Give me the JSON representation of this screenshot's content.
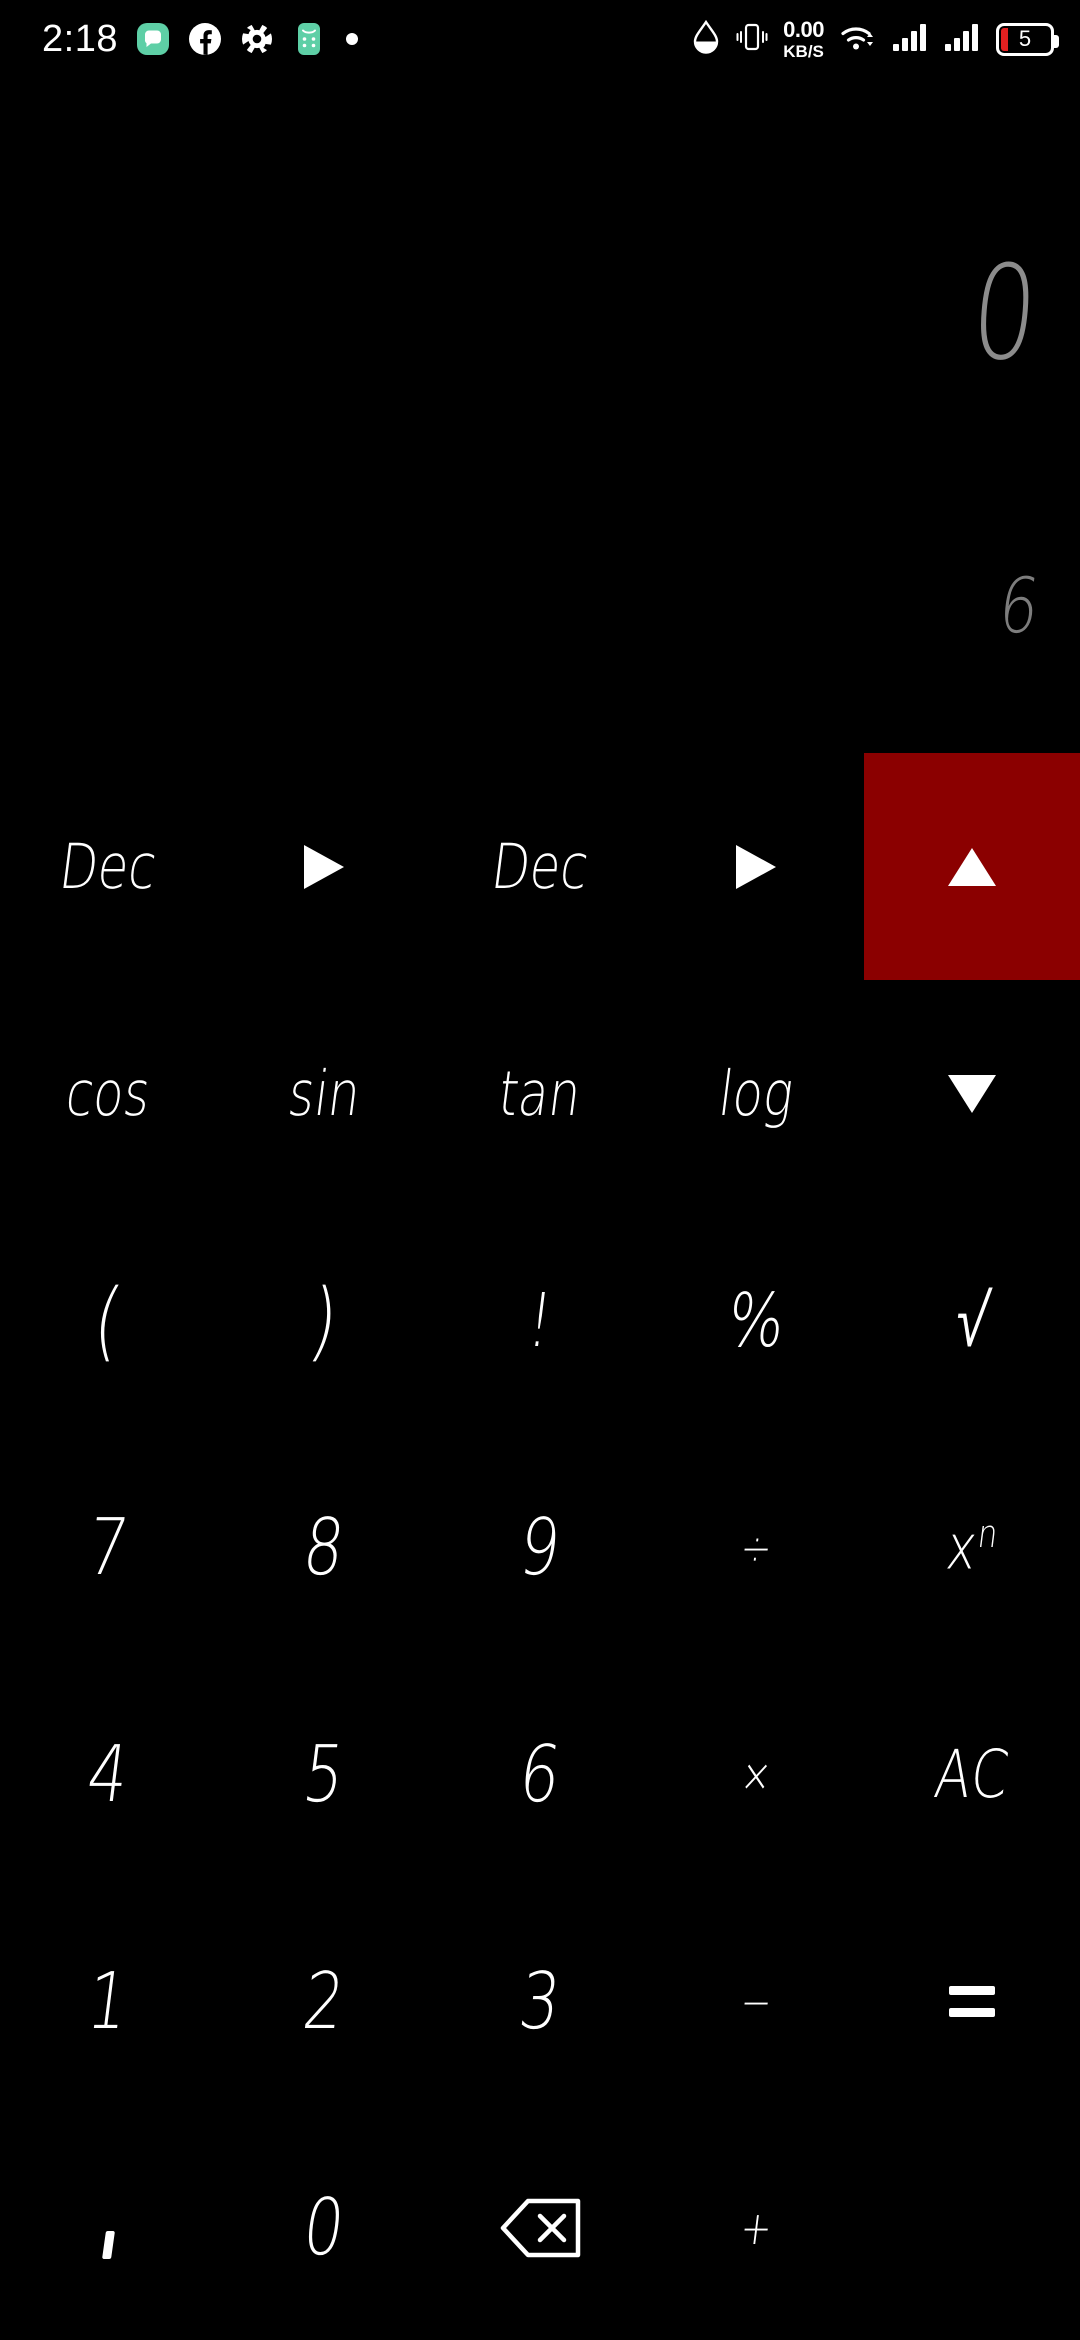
{
  "app": {
    "name": "Calculator",
    "theme_background": "#000000",
    "accent_color": "#8b0000",
    "text_color": "#ffffff",
    "display_text_color": "#8c8c8c"
  },
  "status_bar": {
    "clock": "2:18",
    "left_icons": [
      {
        "name": "messages-icon",
        "label": "Messages"
      },
      {
        "name": "facebook-icon",
        "label": "Facebook"
      },
      {
        "name": "flower-app-icon",
        "label": "App"
      },
      {
        "name": "calculator-app-icon",
        "label": "Calculator"
      },
      {
        "name": "more-notifications-dot-icon",
        "label": "More"
      }
    ],
    "right_icons": [
      {
        "name": "water-drop-icon",
        "label": "Water drop"
      },
      {
        "name": "vibrate-icon",
        "label": "Vibrate"
      },
      {
        "name": "wifi-icon",
        "label": "Wi-Fi"
      },
      {
        "name": "signal-sim1-icon",
        "label": "Signal 1"
      },
      {
        "name": "signal-sim2-icon",
        "label": "Signal 2"
      }
    ],
    "network_speed": {
      "value": "0.00",
      "unit": "KB/S"
    },
    "battery": {
      "level": "5",
      "name": "battery-icon"
    }
  },
  "display": {
    "expression": "0",
    "result": "6"
  },
  "keypad": {
    "rows": [
      [
        {
          "name": "base-input-button",
          "label": "Dec",
          "type": "word",
          "accent": false
        },
        {
          "name": "arrow-right-1-icon",
          "label": "▶",
          "type": "tri-right",
          "accent": false
        },
        {
          "name": "base-output-button",
          "label": "Dec",
          "type": "word",
          "accent": false
        },
        {
          "name": "arrow-right-2-icon",
          "label": "▶",
          "type": "tri-right",
          "accent": false
        },
        {
          "name": "scroll-up-button",
          "label": "▲",
          "type": "tri-up",
          "accent": true
        }
      ],
      [
        {
          "name": "cos-button",
          "label": "cos",
          "type": "word",
          "accent": false
        },
        {
          "name": "sin-button",
          "label": "sin",
          "type": "word",
          "accent": false
        },
        {
          "name": "tan-button",
          "label": "tan",
          "type": "word",
          "accent": false
        },
        {
          "name": "log-button",
          "label": "log",
          "type": "word",
          "accent": false
        },
        {
          "name": "scroll-down-button",
          "label": "▼",
          "type": "tri-down",
          "accent": false
        }
      ],
      [
        {
          "name": "open-paren-button",
          "label": "(",
          "type": "paren",
          "accent": false
        },
        {
          "name": "close-paren-button",
          "label": ")",
          "type": "paren",
          "accent": false
        },
        {
          "name": "factorial-button",
          "label": "!",
          "type": "sym",
          "accent": false
        },
        {
          "name": "percent-button",
          "label": "%",
          "type": "sym",
          "accent": false
        },
        {
          "name": "sqrt-button",
          "label": "√",
          "type": "sym",
          "accent": false
        }
      ],
      [
        {
          "name": "digit-7-button",
          "label": "7",
          "type": "digit",
          "accent": false
        },
        {
          "name": "digit-8-button",
          "label": "8",
          "type": "digit",
          "accent": false
        },
        {
          "name": "digit-9-button",
          "label": "9",
          "type": "digit",
          "accent": false
        },
        {
          "name": "divide-button",
          "label": "÷",
          "type": "small",
          "accent": false
        },
        {
          "name": "power-button",
          "label": "xⁿ",
          "type": "power",
          "accent": false
        }
      ],
      [
        {
          "name": "digit-4-button",
          "label": "4",
          "type": "digit",
          "accent": false
        },
        {
          "name": "digit-5-button",
          "label": "5",
          "type": "digit",
          "accent": false
        },
        {
          "name": "digit-6-button",
          "label": "6",
          "type": "digit",
          "accent": false
        },
        {
          "name": "multiply-button",
          "label": "×",
          "type": "small",
          "accent": false
        },
        {
          "name": "all-clear-button",
          "label": "AC",
          "type": "ac",
          "accent": false
        }
      ],
      [
        {
          "name": "digit-1-button",
          "label": "1",
          "type": "digit",
          "accent": false
        },
        {
          "name": "digit-2-button",
          "label": "2",
          "type": "digit",
          "accent": false
        },
        {
          "name": "digit-3-button",
          "label": "3",
          "type": "digit",
          "accent": false
        },
        {
          "name": "minus-button",
          "label": "−",
          "type": "small",
          "accent": false
        },
        {
          "name": "equals-button",
          "label": "=",
          "type": "equals",
          "accent": false
        }
      ],
      [
        {
          "name": "decimal-separator-button",
          "label": ",",
          "type": "comma",
          "accent": false
        },
        {
          "name": "digit-0-button",
          "label": "0",
          "type": "digit",
          "accent": false
        },
        {
          "name": "backspace-button",
          "label": "⌫",
          "type": "backspace",
          "accent": false
        },
        {
          "name": "plus-button",
          "label": "+",
          "type": "small",
          "accent": false
        },
        {
          "name": "empty-slot",
          "label": "",
          "type": "empty",
          "accent": false
        }
      ]
    ],
    "power_base": "x",
    "power_exponent": "n"
  }
}
